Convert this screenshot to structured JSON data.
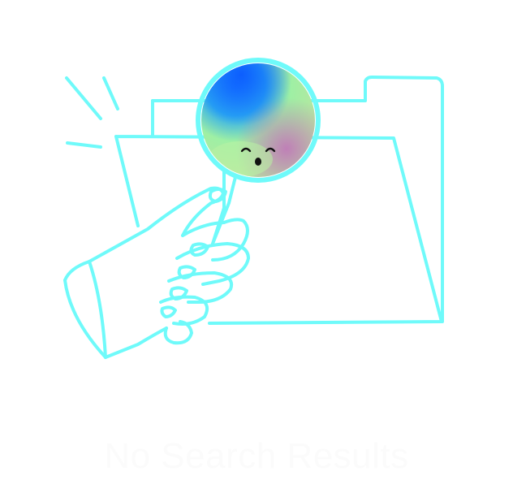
{
  "empty_state": {
    "title": "No Search Results",
    "illustration": {
      "icon": "no-results-illustration",
      "stroke_color": "#6ffafa",
      "lens_gradient_colors": [
        "#0a66ff",
        "#3fa7f5",
        "#a9f3a6",
        "#c07ab8",
        "#9ee8a3"
      ]
    }
  }
}
